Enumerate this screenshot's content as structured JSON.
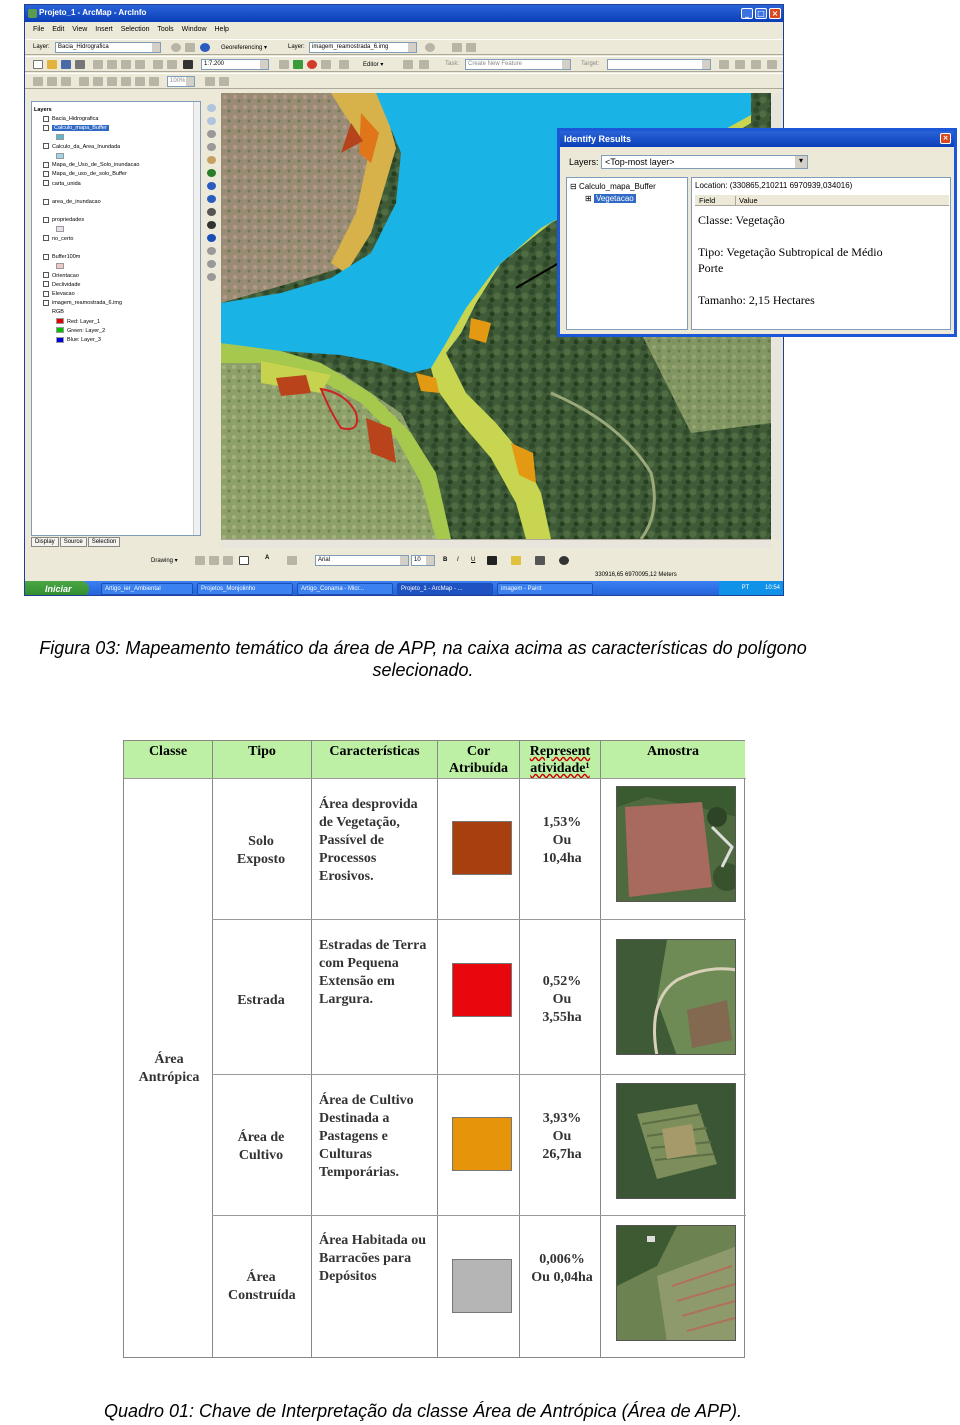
{
  "window": {
    "title": "Projeto_1 - ArcMap - ArcInfo"
  },
  "menu": [
    "File",
    "Edit",
    "View",
    "Insert",
    "Selection",
    "Tools",
    "Window",
    "Help"
  ],
  "toolbar1": {
    "layer_label": "Layer:",
    "layer_value": "Bacia_Hidrografica",
    "georef_label": "Georeferencing ▾",
    "layer2_label": "Layer:",
    "layer2_value": "imagem_reamostrada_6.img"
  },
  "toolbar2": {
    "scale_value": "1:7.200",
    "editor_label": "Editor ▾",
    "task_label": "Task:",
    "task_value": "Create New Feature",
    "target_label": "Target:"
  },
  "toolbar3": {
    "zoom_value": "100%"
  },
  "toc": {
    "items": [
      {
        "label": "Layers",
        "indent": 0,
        "swatch": ""
      },
      {
        "label": "Bacia_Hidrografica",
        "indent": 1,
        "swatch": ""
      },
      {
        "label": "Calculo_mapa_Buffer",
        "indent": 1,
        "swatch": "",
        "selected": true
      },
      {
        "label": "",
        "indent": 2,
        "swatch": "#5fb8c9"
      },
      {
        "label": "Calculo_da_Area_Inundada",
        "indent": 1,
        "swatch": ""
      },
      {
        "label": "",
        "indent": 2,
        "swatch": "#9fd4ea"
      },
      {
        "label": "Mapa_de_Uso_de_Solo_inundacao",
        "indent": 1,
        "swatch": ""
      },
      {
        "label": "Mapa_de_uso_de_solo_Buffer",
        "indent": 1,
        "swatch": ""
      },
      {
        "label": "carta_unida",
        "indent": 1,
        "swatch": ""
      },
      {
        "label": "",
        "indent": 2,
        "swatch": ""
      },
      {
        "label": "area_de_inundacao",
        "indent": 1,
        "swatch": ""
      },
      {
        "label": "",
        "indent": 2,
        "swatch": ""
      },
      {
        "label": "propriedades",
        "indent": 1,
        "swatch": ""
      },
      {
        "label": "",
        "indent": 2,
        "swatch": "#e8e0e8"
      },
      {
        "label": "no_certo",
        "indent": 1,
        "swatch": ""
      },
      {
        "label": "",
        "indent": 2,
        "swatch": ""
      },
      {
        "label": "Buffer100m",
        "indent": 1,
        "swatch": ""
      },
      {
        "label": "",
        "indent": 2,
        "swatch": "#f0c8c8"
      },
      {
        "label": "Orientacao",
        "indent": 1,
        "swatch": ""
      },
      {
        "label": "Declividade",
        "indent": 1,
        "swatch": ""
      },
      {
        "label": "Elevacao",
        "indent": 1,
        "swatch": ""
      },
      {
        "label": "imagem_reamostrada_6.img",
        "indent": 1,
        "swatch": ""
      },
      {
        "label": "RGB",
        "indent": 2,
        "swatch": ""
      },
      {
        "label": "Red:   Layer_1",
        "indent": 2,
        "swatch": "#e00000"
      },
      {
        "label": "Green: Layer_2",
        "indent": 2,
        "swatch": "#00c000"
      },
      {
        "label": "Blue:  Layer_3",
        "indent": 2,
        "swatch": "#0000e0"
      }
    ],
    "tabs": [
      "Display",
      "Source",
      "Selection"
    ]
  },
  "drawbar": {
    "drawing_label": "Drawing ▾",
    "font_value": "Arial",
    "size_value": "10",
    "bold": "B",
    "italic": "I",
    "underline": "U"
  },
  "status": {
    "coords": "330916,65  6970095,12 Meters"
  },
  "taskbar": {
    "start": "Iniciar",
    "tasks": [
      "Artigo_ier_Ambiental",
      "Projetos_Monjolinho",
      "Artigo_Conama - Micr...",
      "Projeto_1 - ArcMap - ...",
      "imagem - Paint"
    ],
    "lang": "PT",
    "clock": "10:54"
  },
  "identify": {
    "title": "Identify Results",
    "layers_label": "Layers:",
    "layers_value": "<Top-most layer>",
    "tree_root": "Calculo_mapa_Buffer",
    "tree_child": "Vegetacao",
    "location": "Location: (330865,210211 6970939,034016)",
    "col_field": "Field",
    "col_value": "Value",
    "classe": "Classe: Vegetação",
    "tipo_line1": "Tipo: Vegetação Subtropical de Médio",
    "tipo_line2": "Porte",
    "tamanho": "Tamanho: 2,15 Hectares"
  },
  "caption1": {
    "line1": "Figura 03: Mapeamento temático da área de APP, na caixa acima as características do polígono",
    "line2": "selecionado."
  },
  "table": {
    "headers": {
      "classe": "Classe",
      "tipo": "Tipo",
      "caracteristicas": "Características",
      "cor": "Cor Atribuída",
      "represent_1": "Represent",
      "represent_2": "atividade¹",
      "amostra": "Amostra"
    },
    "classe_value": "Área Antrópica",
    "rows": [
      {
        "tipo": "Solo Exposto",
        "caracteristicas": "Área desprovida de Vegetação, Passível de Processos Erosivos.",
        "cor": "#a7400e",
        "represent": "1,53% Ou 10,4ha"
      },
      {
        "tipo": "Estrada",
        "caracteristicas": "Estradas de Terra com Pequena Extensão em Largura.",
        "cor": "#e8070c",
        "represent": "0,52% Ou 3,55ha"
      },
      {
        "tipo": "Área de Cultivo",
        "caracteristicas": "Área de Cultivo Destinada a Pastagens e Culturas Temporárias.",
        "cor": "#e6950a",
        "represent": "3,93% Ou 26,7ha"
      },
      {
        "tipo": "Área Construída",
        "caracteristicas": "Área Habitada ou Barracões para Depósitos",
        "cor": "#b5b5b5",
        "represent": "0,006% Ou 0,04ha"
      }
    ]
  },
  "caption2": "Quadro 01: Chave de Interpretação da classe Área de Antrópica (Área de APP)."
}
